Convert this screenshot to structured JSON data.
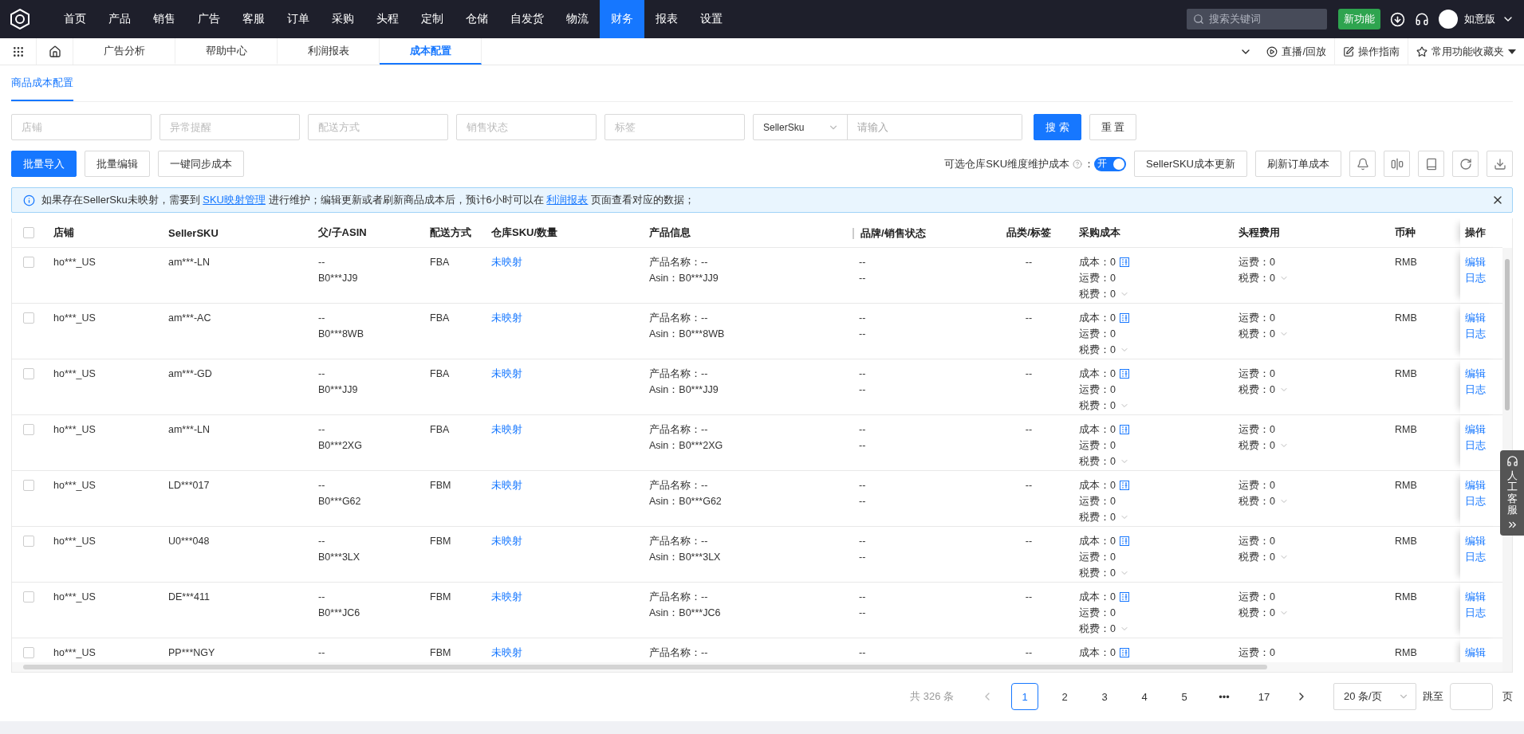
{
  "nav": {
    "items": [
      {
        "label": "首页",
        "selected": false
      },
      {
        "label": "产品",
        "selected": false
      },
      {
        "label": "销售",
        "selected": false
      },
      {
        "label": "广告",
        "selected": false
      },
      {
        "label": "客服",
        "selected": false
      },
      {
        "label": "订单",
        "selected": false
      },
      {
        "label": "采购",
        "selected": false
      },
      {
        "label": "头程",
        "selected": false
      },
      {
        "label": "定制",
        "selected": false
      },
      {
        "label": "仓储",
        "selected": false
      },
      {
        "label": "自发货",
        "selected": false
      },
      {
        "label": "物流",
        "selected": false
      },
      {
        "label": "财务",
        "selected": true
      },
      {
        "label": "报表",
        "selected": false
      },
      {
        "label": "设置",
        "selected": false
      }
    ],
    "search_placeholder": "搜索关键词",
    "new_feature": "新功能",
    "edition": "如意版"
  },
  "tabs": [
    {
      "label": "广告分析",
      "selected": false
    },
    {
      "label": "帮助中心",
      "selected": false
    },
    {
      "label": "利润报表",
      "selected": false
    },
    {
      "label": "成本配置",
      "selected": true
    }
  ],
  "tab_actions": {
    "live": "直播/回放",
    "guide": "操作指南",
    "favorites": "常用功能收藏夹"
  },
  "sub_tabs": [
    {
      "label": "商品成本配置",
      "selected": true
    }
  ],
  "filters": [
    {
      "placeholder": "店铺"
    },
    {
      "placeholder": "异常提醒"
    },
    {
      "placeholder": "配送方式"
    },
    {
      "placeholder": "销售状态"
    },
    {
      "placeholder": "标签"
    }
  ],
  "search": {
    "field": "SellerSku",
    "placeholder": "请输入",
    "search_button": "搜 索",
    "reset_button": "重 置"
  },
  "actions": [
    {
      "label": "批量导入",
      "kind": "primary"
    },
    {
      "label": "批量编辑",
      "kind": "default"
    },
    {
      "label": "一键同步成本",
      "kind": "default"
    }
  ],
  "toggle": {
    "label": "可选仓库SKU维度维护成本",
    "suffix": "：",
    "on": true,
    "text": "开"
  },
  "right_buttons": [
    "SellerSKU成本更新",
    "刷新订单成本"
  ],
  "alert": {
    "parts": [
      {
        "kind": "text",
        "text": "如果存在SellerSku未映射，需要到 "
      },
      {
        "kind": "link",
        "text": "SKU映射管理"
      },
      {
        "kind": "text",
        "text": " 进行维护；编辑更新或者刷新商品成本后，预计6小时可以在 "
      },
      {
        "kind": "link",
        "text": "利润报表"
      },
      {
        "kind": "text",
        "text": " 页面查看对应的数据；"
      }
    ]
  },
  "table": {
    "all_checked": false,
    "columns": [
      "店铺",
      "SellerSKU",
      "父/子ASIN",
      "配送方式",
      "仓库SKU/数量",
      "产品信息",
      "品牌/销售状态",
      "品类/标签",
      "采购成本",
      "头程费用",
      "币种",
      "操作"
    ],
    "rows": [
      {
        "checked": false,
        "shop": "ho***_US",
        "seller_sku": "am***-LN",
        "asin": [
          "--",
          "B0***JJ9"
        ],
        "fulfillment": "FBA",
        "warehouse": "未映射",
        "product": [
          "产品名称：--",
          "Asin：B0***JJ9"
        ],
        "brand": [
          "--",
          "--"
        ],
        "category": "--",
        "purchase": [
          "成本：0",
          "运费：0",
          "税费：0"
        ],
        "headway": [
          "运费：0",
          "税费：0"
        ],
        "currency": "RMB",
        "ops": [
          "编辑",
          "日志"
        ]
      },
      {
        "checked": false,
        "shop": "ho***_US",
        "seller_sku": "am***-AC",
        "asin": [
          "--",
          "B0***8WB"
        ],
        "fulfillment": "FBA",
        "warehouse": "未映射",
        "product": [
          "产品名称：--",
          "Asin：B0***8WB"
        ],
        "brand": [
          "--",
          "--"
        ],
        "category": "--",
        "purchase": [
          "成本：0",
          "运费：0",
          "税费：0"
        ],
        "headway": [
          "运费：0",
          "税费：0"
        ],
        "currency": "RMB",
        "ops": [
          "编辑",
          "日志"
        ]
      },
      {
        "checked": false,
        "shop": "ho***_US",
        "seller_sku": "am***-GD",
        "asin": [
          "--",
          "B0***JJ9"
        ],
        "fulfillment": "FBA",
        "warehouse": "未映射",
        "product": [
          "产品名称：--",
          "Asin：B0***JJ9"
        ],
        "brand": [
          "--",
          "--"
        ],
        "category": "--",
        "purchase": [
          "成本：0",
          "运费：0",
          "税费：0"
        ],
        "headway": [
          "运费：0",
          "税费：0"
        ],
        "currency": "RMB",
        "ops": [
          "编辑",
          "日志"
        ]
      },
      {
        "checked": false,
        "shop": "ho***_US",
        "seller_sku": "am***-LN",
        "asin": [
          "--",
          "B0***2XG"
        ],
        "fulfillment": "FBA",
        "warehouse": "未映射",
        "product": [
          "产品名称：--",
          "Asin：B0***2XG"
        ],
        "brand": [
          "--",
          "--"
        ],
        "category": "--",
        "purchase": [
          "成本：0",
          "运费：0",
          "税费：0"
        ],
        "headway": [
          "运费：0",
          "税费：0"
        ],
        "currency": "RMB",
        "ops": [
          "编辑",
          "日志"
        ]
      },
      {
        "checked": false,
        "shop": "ho***_US",
        "seller_sku": "LD***017",
        "asin": [
          "--",
          "B0***G62"
        ],
        "fulfillment": "FBM",
        "warehouse": "未映射",
        "product": [
          "产品名称：--",
          "Asin：B0***G62"
        ],
        "brand": [
          "--",
          "--"
        ],
        "category": "--",
        "purchase": [
          "成本：0",
          "运费：0",
          "税费：0"
        ],
        "headway": [
          "运费：0",
          "税费：0"
        ],
        "currency": "RMB",
        "ops": [
          "编辑",
          "日志"
        ]
      },
      {
        "checked": false,
        "shop": "ho***_US",
        "seller_sku": "U0***048",
        "asin": [
          "--",
          "B0***3LX"
        ],
        "fulfillment": "FBM",
        "warehouse": "未映射",
        "product": [
          "产品名称：--",
          "Asin：B0***3LX"
        ],
        "brand": [
          "--",
          "--"
        ],
        "category": "--",
        "purchase": [
          "成本：0",
          "运费：0",
          "税费：0"
        ],
        "headway": [
          "运费：0",
          "税费：0"
        ],
        "currency": "RMB",
        "ops": [
          "编辑",
          "日志"
        ]
      },
      {
        "checked": false,
        "shop": "ho***_US",
        "seller_sku": "DE***411",
        "asin": [
          "--",
          "B0***JC6"
        ],
        "fulfillment": "FBM",
        "warehouse": "未映射",
        "product": [
          "产品名称：--",
          "Asin：B0***JC6"
        ],
        "brand": [
          "--",
          "--"
        ],
        "category": "--",
        "purchase": [
          "成本：0",
          "运费：0",
          "税费：0"
        ],
        "headway": [
          "运费：0",
          "税费：0"
        ],
        "currency": "RMB",
        "ops": [
          "编辑",
          "日志"
        ]
      },
      {
        "checked": false,
        "shop": "ho***_US",
        "seller_sku": "PP***NGY",
        "asin": [
          "--"
        ],
        "fulfillment": "FBM",
        "warehouse": "未映射",
        "product": [
          "产品名称：--"
        ],
        "brand": [
          "--"
        ],
        "category": "--",
        "purchase": [
          "成本：0"
        ],
        "headway": [
          "运费：0"
        ],
        "currency": "RMB",
        "ops": [
          "编辑"
        ]
      }
    ]
  },
  "pagination": {
    "total": "共 326 条",
    "pages": [
      {
        "label": "1",
        "selected": true
      },
      {
        "label": "2",
        "selected": false
      },
      {
        "label": "3",
        "selected": false
      },
      {
        "label": "4",
        "selected": false
      },
      {
        "label": "5",
        "selected": false
      },
      {
        "label": "•••",
        "selected": false
      },
      {
        "label": "17",
        "selected": false
      }
    ],
    "page_size": "20 条/页",
    "jump_label": "跳至",
    "page_suffix": "页"
  },
  "service_widget": {
    "label": "人工客服"
  }
}
